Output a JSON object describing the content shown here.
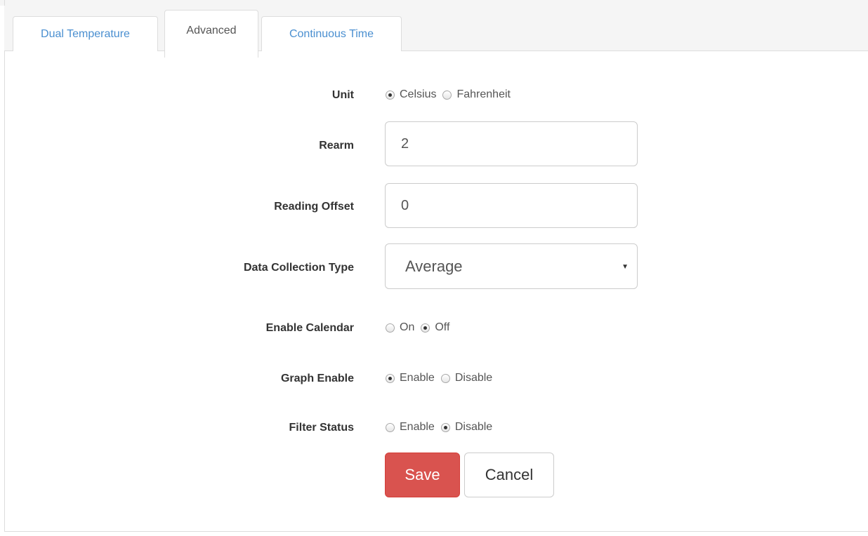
{
  "tabs": [
    {
      "label": "Dual Temperature",
      "active": false
    },
    {
      "label": "Advanced",
      "active": true
    },
    {
      "label": "Continuous Time",
      "active": false
    }
  ],
  "form": {
    "unit": {
      "label": "Unit",
      "options": [
        "Celsius",
        "Fahrenheit"
      ],
      "selected": "Celsius"
    },
    "rearm": {
      "label": "Rearm",
      "value": "2"
    },
    "reading_offset": {
      "label": "Reading Offset",
      "value": "0"
    },
    "data_collection_type": {
      "label": "Data Collection Type",
      "selected": "Average"
    },
    "enable_calendar": {
      "label": "Enable Calendar",
      "options": [
        "On",
        "Off"
      ],
      "selected": "Off"
    },
    "graph_enable": {
      "label": "Graph Enable",
      "options": [
        "Enable",
        "Disable"
      ],
      "selected": "Enable"
    },
    "filter_status": {
      "label": "Filter Status",
      "options": [
        "Enable",
        "Disable"
      ],
      "selected": "Disable"
    }
  },
  "buttons": {
    "save": "Save",
    "cancel": "Cancel"
  },
  "colors": {
    "tab_link": "#4a8fd0",
    "save_button": "#d9534f"
  }
}
